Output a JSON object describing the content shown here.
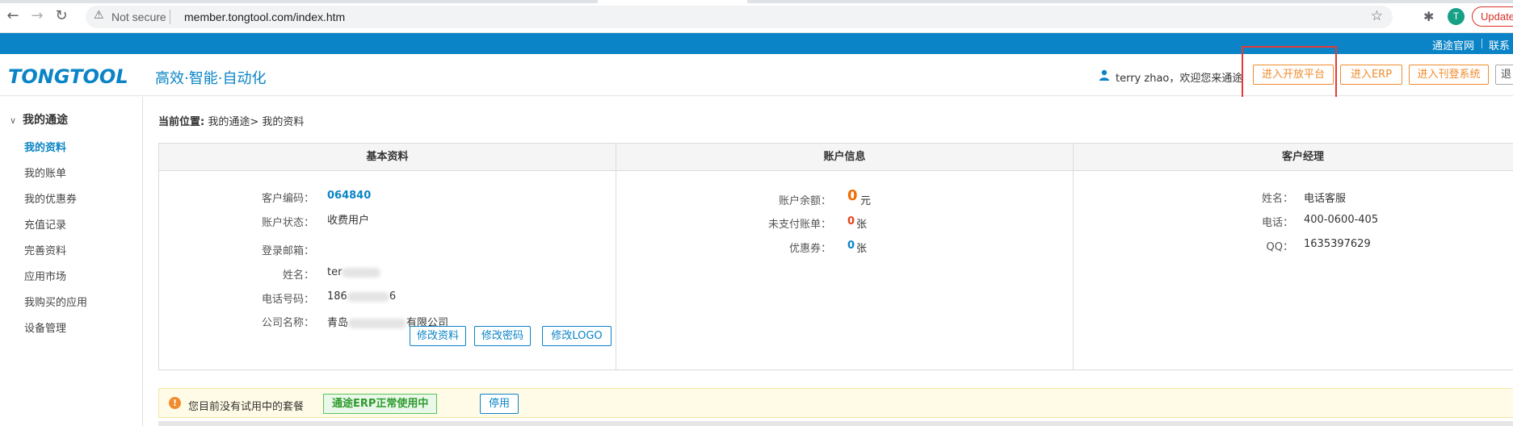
{
  "browser": {
    "not_secure": "Not secure",
    "url": "member.tongtool.com/index.htm",
    "profile_initial": "T",
    "update_label": "Update"
  },
  "topbar": {
    "link1": "通途官网",
    "link2": "联系"
  },
  "header": {
    "logo": "TONGTOOL",
    "slogan": "高效·智能·自动化",
    "welcome": "terry zhao，欢迎您来通途",
    "btn_open_platform": "进入开放平台",
    "btn_erp": "进入ERP",
    "btn_listing": "进入刊登系统",
    "btn_exit": "退"
  },
  "sidebar": {
    "title": "我的通途",
    "items": [
      "我的资料",
      "我的账单",
      "我的优惠券",
      "充值记录",
      "完善资料",
      "应用市场",
      "我购买的应用",
      "设备管理"
    ],
    "active_index": 0
  },
  "breadcrumb": {
    "label": "当前位置:",
    "path": "我的通途> 我的资料"
  },
  "basic": {
    "title": "基本资料",
    "rows": [
      {
        "label": "客户编码：",
        "value": "064840"
      },
      {
        "label": "账户状态：",
        "value": "收费用户"
      },
      {
        "label": "登录邮箱：",
        "value": ""
      },
      {
        "label": "姓名：",
        "value": "ter"
      },
      {
        "label": "电话号码：",
        "value": "186"
      },
      {
        "label": "公司名称：",
        "value_prefix": "青岛",
        "value_suffix": "有限公司"
      }
    ],
    "tail_6": "6",
    "btn_edit_info": "修改资料",
    "btn_edit_pwd": "修改密码",
    "btn_edit_logo": "修改LOGO"
  },
  "account": {
    "title": "账户信息",
    "balance_label": "账户余额：",
    "balance_value": "0",
    "balance_unit": "元",
    "unpaid_label": "未支付账单：",
    "unpaid_value": "0",
    "unpaid_unit": "张",
    "coupon_label": "优惠券：",
    "coupon_value": "0",
    "coupon_unit": "张"
  },
  "manager": {
    "title": "客户经理",
    "name_label": "姓名：",
    "name_value": "电话客服",
    "phone_label": "电话：",
    "phone_value": "400-0600-405",
    "qq_label": "QQ：",
    "qq_value": "1635397629"
  },
  "notice": {
    "text": "您目前没有试用中的套餐",
    "badge": "通途ERP正常使用中",
    "stop_label": "停用"
  }
}
